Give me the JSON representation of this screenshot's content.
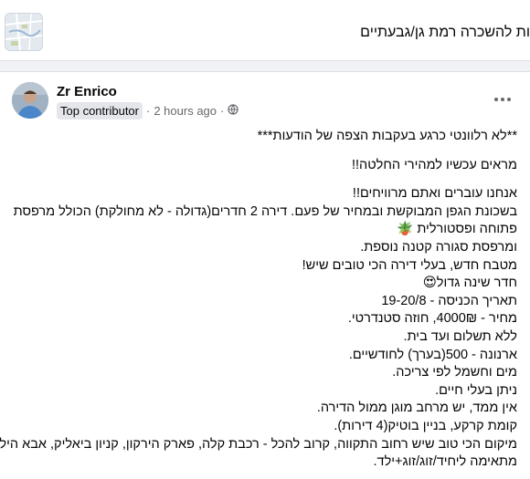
{
  "group": {
    "title": "ות להשכרה רמת גן/גבעתיים"
  },
  "post": {
    "author": "Zr Enrico",
    "badge": "Top contributor",
    "separator": "·",
    "time": "2 hours ago",
    "privacy_icon": "globe-icon",
    "more_icon": "more-options-icon",
    "lines": [
      "**לא רלוונטי כרגע בעקבות הצפה של הודעות***",
      "מראים עכשיו למהירי החלטה!!",
      "אנחנו עוברים ואתם מרוויחים!!",
      "בשכונת הגפן המבוקשת ובמחיר של פעם. דירה 2 חדרים(גדולה - לא מחולקת) הכולל מרפסת",
      "פתוחה ופסטורלית 🪴",
      "ומרפסת סגורה קטנה נוספת.",
      "מטבח חדש, בעלי דירה הכי טובים שיש!",
      "חדר שינה גדול😍",
      "תאריך הכניסה - 19-20/8",
      "מחיר - 4000₪, חוזה סטנדרטי.",
      "ללא תשלום ועד בית.",
      "ארנונה - 500(בערך) לחודשיים.",
      "מים וחשמל לפי צריכה.",
      "ניתן בעלי חיים.",
      "אין ממד, יש מרחב מוגן ממול הדירה.",
      "קומת קרקע, בניין בוטיק(4 דירות).",
      "מיקום הכי טוב שיש רחוב התקווה, קרוב להכל - רכבת קלה, פארק הירקון, קניון ביאליק, אבא הילל.",
      "מתאימה ליחיד/זוג/זוג+ילד."
    ]
  }
}
